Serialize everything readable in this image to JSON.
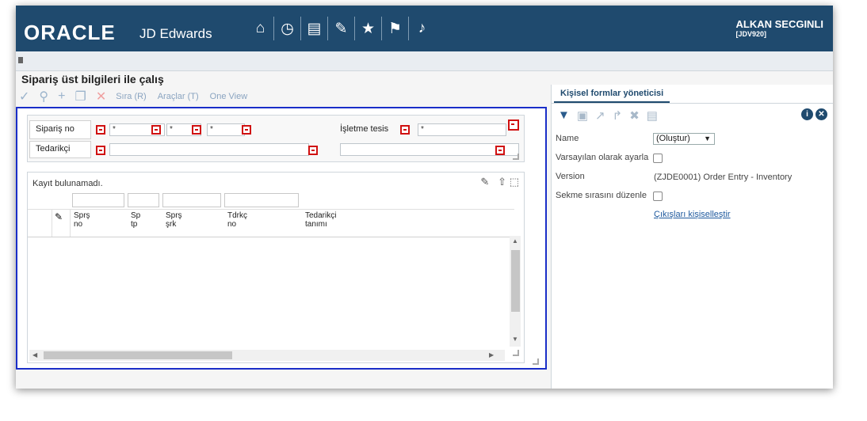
{
  "brand": {
    "name": "ORACLE",
    "product": "JD Edwards"
  },
  "nav_icons": [
    "home-icon",
    "clock-icon",
    "chart-icon",
    "edit-icon",
    "star-icon",
    "flag-icon",
    "bell-icon"
  ],
  "user": {
    "name": "ALKAN SECGINLI",
    "env": "[JDV920]"
  },
  "app": {
    "title": "Sipariş üst bilgileri ile çalış"
  },
  "toolbar": {
    "sequence": "Sıra (R)",
    "tools": "Araçlar (T)",
    "oneview": "One View"
  },
  "header_form": {
    "order_no_label": "Sipariş no",
    "order_no_values": [
      "*",
      "*",
      "*"
    ],
    "supplier_label": "Tedarikçi",
    "right_label": "İşletme tesis",
    "right_value": "*"
  },
  "grid": {
    "no_records": "Kayıt bulunamadı.",
    "columns": [
      {
        "line1": "Sprş",
        "line2": "no"
      },
      {
        "line1": "Sp",
        "line2": "tp"
      },
      {
        "line1": "Sprş",
        "line2": "şrk"
      },
      {
        "line1": "Tdrkç",
        "line2": "no"
      },
      {
        "line1": "Tedarikçi",
        "line2": "tanımı"
      }
    ]
  },
  "side_panel": {
    "tab": "Kişisel formlar yöneticisi",
    "name_label": "Name",
    "name_value": "(Oluştur)",
    "default_label": "Varsayılan olarak ayarla",
    "version_label": "Version",
    "version_value": "(ZJDE0001) Order Entry - Inventory",
    "tab_order_label": "Sekme sırasını düzenle",
    "exits_link": "Çıkışları kişiselleştir"
  },
  "colors": {
    "header_bg": "#1f4a6e",
    "required": "#d01010",
    "form_border": "#1a2ec8"
  }
}
